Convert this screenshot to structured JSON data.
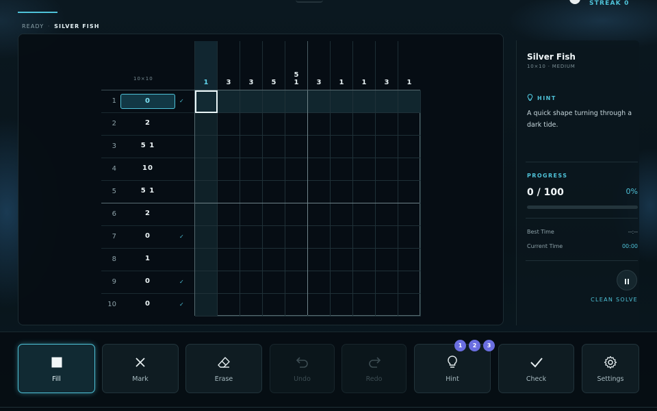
{
  "header": {
    "streak_label": "STREAK 0",
    "status": {
      "state": "READY",
      "separator": "·",
      "puzzle": "SILVER FISH"
    }
  },
  "board": {
    "size_label": "10×10",
    "active_row": 1,
    "active_col": 1,
    "column_clues": [
      [
        "1"
      ],
      [
        "3"
      ],
      [
        "3"
      ],
      [
        "5"
      ],
      [
        "5",
        "1"
      ],
      [
        "3"
      ],
      [
        "1"
      ],
      [
        "1"
      ],
      [
        "3"
      ],
      [
        "1"
      ]
    ],
    "rows": [
      {
        "num": "1",
        "clue": "0",
        "solved": true
      },
      {
        "num": "2",
        "clue": "2",
        "solved": false
      },
      {
        "num": "3",
        "clue": "5 1",
        "solved": false
      },
      {
        "num": "4",
        "clue": "10",
        "solved": false
      },
      {
        "num": "5",
        "clue": "5 1",
        "solved": false
      },
      {
        "num": "6",
        "clue": "2",
        "solved": false
      },
      {
        "num": "7",
        "clue": "0",
        "solved": true
      },
      {
        "num": "8",
        "clue": "1",
        "solved": false
      },
      {
        "num": "9",
        "clue": "0",
        "solved": true
      },
      {
        "num": "10",
        "clue": "0",
        "solved": true
      }
    ],
    "check_mark": "✓"
  },
  "sidebar": {
    "puzzle_name": "Silver Fish",
    "puzzle_meta": "10×10 · MEDIUM",
    "hint_heading": "HINT",
    "hint_text": "A quick shape turning through a dark tide.",
    "progress_heading": "PROGRESS",
    "progress_count": "0 / 100",
    "progress_percent": "0%",
    "progress_fraction": 0,
    "best_time_label": "Best Time",
    "best_time_value": "--:--",
    "current_time_label": "Current Time",
    "current_time_value": "00:00",
    "clean_solve_label": "CLEAN SOLVE"
  },
  "toolbar": {
    "tools": [
      {
        "id": "fill",
        "label": "Fill",
        "icon": "square-icon",
        "state": "active"
      },
      {
        "id": "mark",
        "label": "Mark",
        "icon": "x-icon",
        "state": "normal"
      },
      {
        "id": "erase",
        "label": "Erase",
        "icon": "eraser-icon",
        "state": "normal"
      },
      {
        "id": "undo",
        "label": "Undo",
        "icon": "undo-icon",
        "state": "disabled"
      },
      {
        "id": "redo",
        "label": "Redo",
        "icon": "redo-icon",
        "state": "disabled"
      },
      {
        "id": "hint",
        "label": "Hint",
        "icon": "lightbulb-icon",
        "state": "normal"
      },
      {
        "id": "check",
        "label": "Check",
        "icon": "check-icon",
        "state": "normal"
      },
      {
        "id": "settings",
        "label": "Settings",
        "icon": "gear-icon",
        "state": "normal"
      }
    ],
    "hint_badges": [
      "1",
      "2",
      "3"
    ]
  },
  "colors": {
    "accent": "#4fc3d9",
    "badge": "#6a6ee0",
    "background": "#071219"
  }
}
